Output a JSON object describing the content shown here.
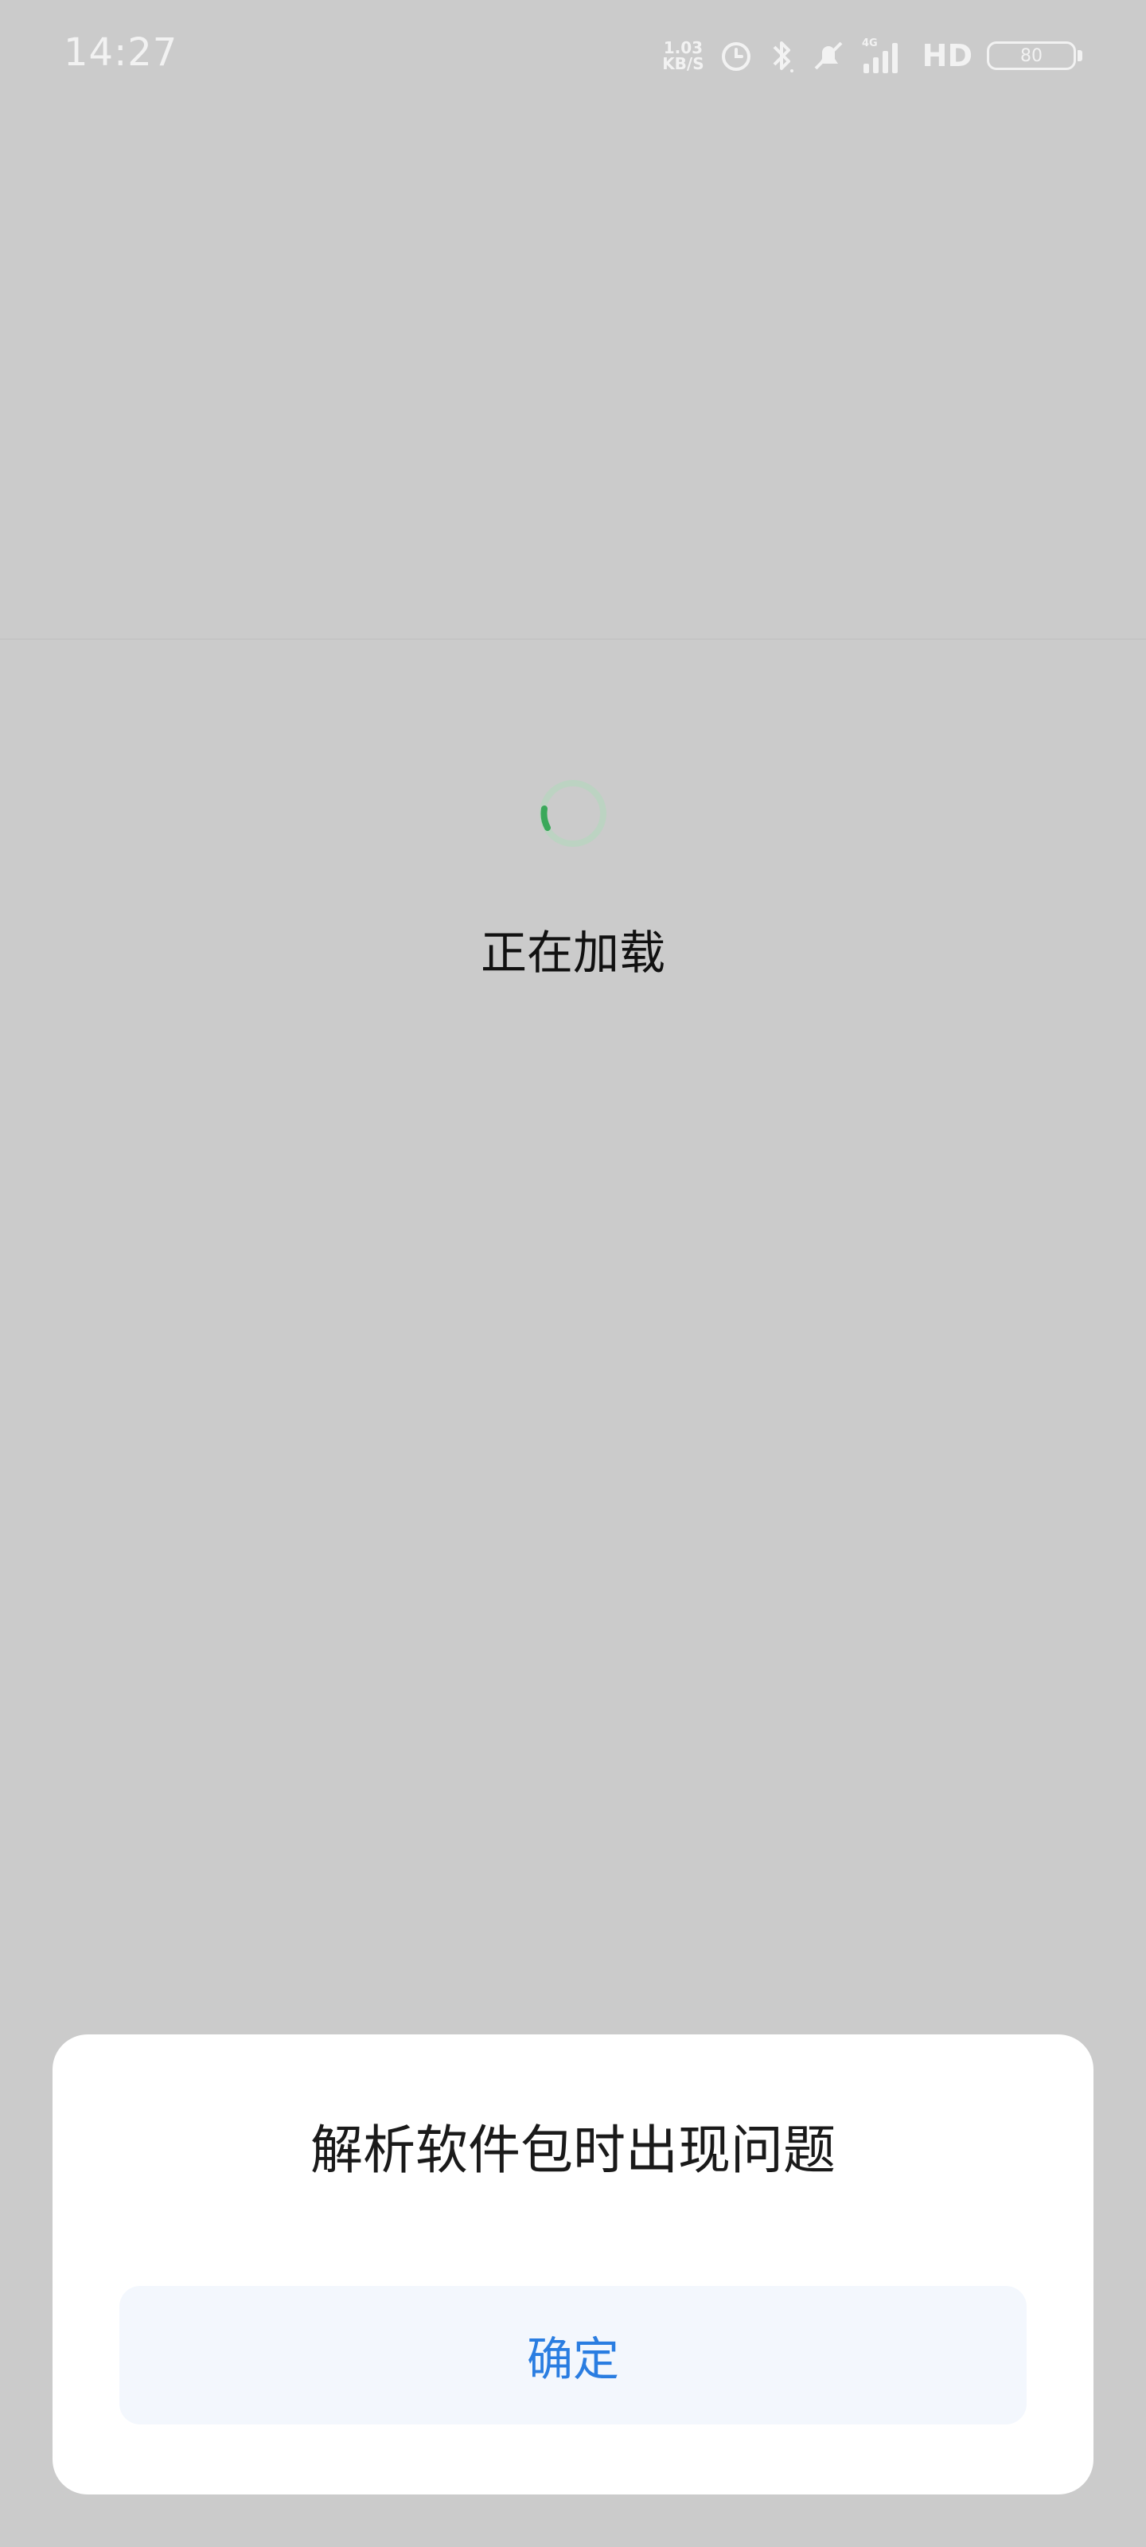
{
  "status_bar": {
    "time": "14:27",
    "net_speed_value": "1.03",
    "net_speed_unit": "KB/S",
    "network_type": "4G",
    "hd_label": "HD",
    "battery_level": "80",
    "icons": [
      "alarm-icon",
      "bluetooth-icon",
      "mute-icon",
      "signal-icon",
      "battery-icon"
    ]
  },
  "main": {
    "loading_text": "正在加载"
  },
  "dialog": {
    "title": "解析软件包时出现问题",
    "confirm_label": "确定"
  },
  "colors": {
    "background_dim": "#cbcbcb",
    "accent_blue": "#2a7de1",
    "spinner_green": "#3aa85a",
    "dialog_bg": "#ffffff",
    "button_bg": "#f3f7fd"
  }
}
